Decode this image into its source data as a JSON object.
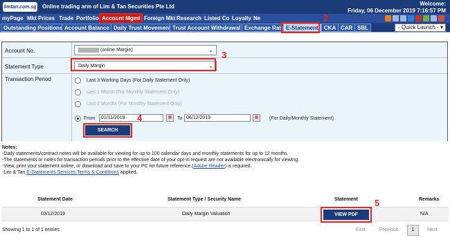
{
  "header": {
    "logo_text": "limtan.com.sg",
    "tagline": "Online trading arm of Lim & Tan Securities Pte Ltd",
    "welcome": "Welcome:",
    "datetime": "Friday, 06 December 2019 7:16:57 PM"
  },
  "mainnav": {
    "tabs": [
      "myPage",
      "Mkt Prices",
      "Trade",
      "Portfolio",
      "Account Mgmt",
      "Foreign Mkt",
      "Research",
      "Listed Co",
      "Loyalty",
      "Ne"
    ]
  },
  "subnav": {
    "tabs": [
      "Outstanding Positions",
      "Account Balance",
      "Daily Trust Movement",
      "Trust Account Withdrawal",
      "Exchange Rate",
      "E-Statement",
      "CKA",
      "CAR",
      "SBL"
    ],
    "quick_launch": "- Quick Launch -"
  },
  "annotations": [
    "2",
    "3",
    "4",
    "5"
  ],
  "form": {
    "account_label": "Account No.",
    "account_value": "(online Margin)",
    "statement_type_label": "Statement Type",
    "statement_type_value": "Daily Margin",
    "period_label": "Transaction Period",
    "options": [
      "Last 3 Working Days (For Daily Statement Only)",
      "Last 1 Month (For Monthly Statement Only)",
      "Last 2 Months (For Monthly Statement Only)"
    ],
    "from_label": "From",
    "from_value": "01/11/2019",
    "to_label": "To",
    "to_value": "06/12/2019",
    "range_note": "(For Daily/Monthly Statement)",
    "search_label": "SEARCH"
  },
  "notes": {
    "title": "Notes:",
    "line1": "-Daily statements/contract notes will be available for viewing for up to 100 calendar days and monthly statements for up to 12 months.",
    "line2": "-The statements or notes for transaction periods prior to the effective date of your opt-in request are not available electronically for viewing.",
    "line3_pre": "-View, print your statement online, or download and save to your PC for future reference.(",
    "line3_link": "Adobe Reader",
    "line3_post": ") is required.",
    "line4_pre": "-Lim & Tan ",
    "line4_link": "E-Statements Services Terms & Conditions",
    "line4_post": " applied."
  },
  "table": {
    "headers": [
      "Statement Date",
      "Statement Type / Security Name",
      "Statement",
      "Remarks"
    ],
    "row": {
      "date": "03/12/2019",
      "type": "Daily Margin Valuation",
      "button": "VIEW PDF",
      "remarks": "N/A"
    }
  },
  "footer": {
    "showing": "Showing 1 to 1 of 1 entries",
    "first": "First",
    "previous": "Previous",
    "page": "1",
    "next": "Next"
  }
}
